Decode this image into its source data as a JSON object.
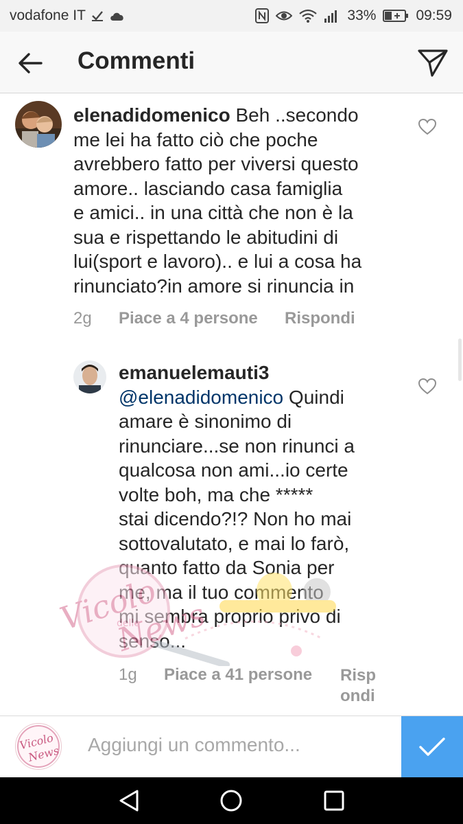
{
  "status_bar": {
    "carrier": "vodafone IT",
    "battery": "33%",
    "time": "09:59"
  },
  "header": {
    "title": "Commenti"
  },
  "comments": [
    {
      "username": "elenadidomenico",
      "text_lines": [
        " Beh ..secondo",
        "me lei ha fatto ciò che poche",
        "avrebbero fatto per viversi questo",
        "amore.. lasciando casa famiglia",
        "e amici.. in una città che non è la",
        "sua e rispettando le abitudini di",
        "lui(sport e lavoro).. e lui a cosa ha",
        "rinunciato?in amore  si rinuncia in"
      ],
      "time": "2g",
      "likes": "Piace a 4 persone",
      "reply": "Rispondi"
    },
    {
      "username": "emanuelemauti3",
      "mention": "@elenadidomenico",
      "text_lines": [
        " Quindi",
        "amare è sinonimo di",
        "rinunciare...se non rinunci a",
        "qualcosa non ami...io certe",
        "volte boh, ma che *****",
        "stai dicendo?!? Non ho mai",
        "sottovalutato, e mai lo farò,",
        "quanto fatto da Sonia per",
        "me, ma il tuo commento",
        "mi sembra proprio privo di",
        "senso..."
      ],
      "time": "1g",
      "likes": "Piace a 41 persone",
      "reply_lines": [
        "Risp",
        "ondi"
      ]
    }
  ],
  "input": {
    "placeholder": "Aggiungi un commento..."
  },
  "watermark": {
    "text": "Vicolo delle News"
  },
  "colors": {
    "post_button": "#4aa2f0",
    "mention": "#003569",
    "meta": "#999999"
  }
}
